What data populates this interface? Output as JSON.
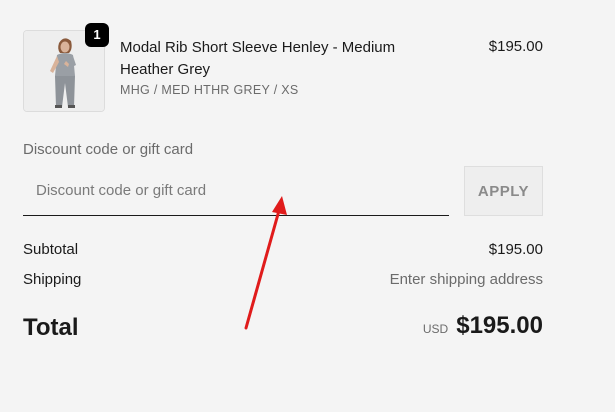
{
  "product": {
    "title": "Modal Rib Short Sleeve Henley - Medium Heather Grey",
    "variant": "MHG / MED HTHR GREY / XS",
    "price": "$195.00",
    "quantity": "1"
  },
  "discount": {
    "label": "Discount code or gift card",
    "placeholder": "Discount code or gift card",
    "value": "",
    "apply_label": "APPLY"
  },
  "summary": {
    "subtotal_label": "Subtotal",
    "subtotal_value": "$195.00",
    "shipping_label": "Shipping",
    "shipping_value": "Enter shipping address"
  },
  "total": {
    "label": "Total",
    "currency": "USD",
    "amount": "$195.00"
  },
  "colors": {
    "background": "#f4f4f4",
    "text": "#1a1a1a",
    "muted": "#6b6b6b",
    "annotation_arrow": "#e01b1b"
  }
}
